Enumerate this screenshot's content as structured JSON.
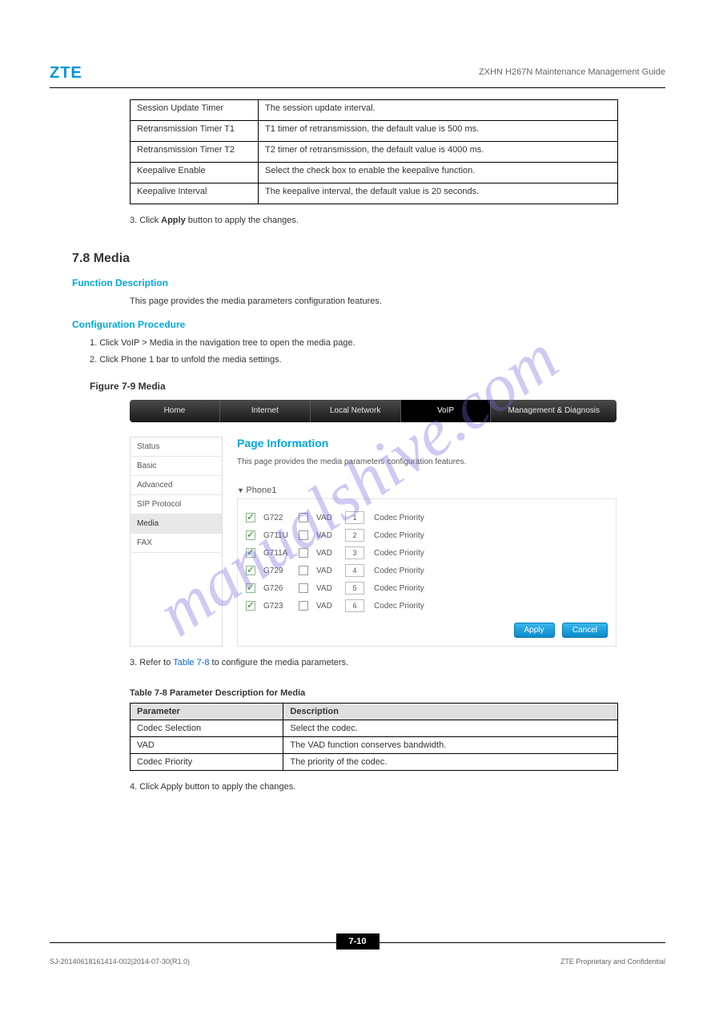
{
  "brand": "ZTE",
  "doc_title": "ZXHN H267N Maintenance Management Guide",
  "watermark": "manualshive.com",
  "param_table": [
    {
      "name": "Session Update Timer",
      "desc": "The session update interval."
    },
    {
      "name": "Retransmission Timer T1",
      "desc": "T1 timer of retransmission, the default value is 500 ms."
    },
    {
      "name": "Retransmission Timer T2",
      "desc": "T2 timer of retransmission, the default value is 4000 ms."
    },
    {
      "name": "Keepalive Enable",
      "desc": "Select the check box to enable the keepalive function."
    },
    {
      "name": "Keepalive Interval",
      "desc": "The keepalive interval, the default value is 20 seconds."
    }
  ],
  "step3": {
    "num": "3.",
    "text_prefix": "Click ",
    "btn": "Apply",
    "text_suffix": " button to apply the changes."
  },
  "heading": "7.8 Media",
  "func_label": "Function Description",
  "func_text": "This page provides the media parameters configuration features.",
  "conf_label": "Configuration Procedure",
  "conf_steps": [
    "1.  Click VoIP > Media in the navigation tree to open the media page.",
    "2.  Click Phone 1 bar to unfold the media settings."
  ],
  "figure_label": "Figure 7-9  Media",
  "nav": {
    "items": [
      "Home",
      "Internet",
      "Local Network",
      "VoIP",
      "Management & Diagnosis"
    ],
    "active": "VoIP"
  },
  "sidebar": {
    "items": [
      "Status",
      "Basic",
      "Advanced",
      "SIP Protocol",
      "Media",
      "FAX"
    ],
    "active": "Media"
  },
  "panel": {
    "title": "Page Information",
    "desc": "This page provides the media parameters configuration features.",
    "accordion_header": "Phone1",
    "codecs": [
      {
        "name": "G722",
        "codec_checked": true,
        "vad_label": "VAD",
        "priority": "1",
        "pri_label": "Codec Priority"
      },
      {
        "name": "G711U",
        "codec_checked": true,
        "vad_label": "VAD",
        "priority": "2",
        "pri_label": "Codec Priority"
      },
      {
        "name": "G711A",
        "codec_checked": true,
        "vad_label": "VAD",
        "priority": "3",
        "pri_label": "Codec Priority"
      },
      {
        "name": "G729",
        "codec_checked": true,
        "vad_label": "VAD",
        "priority": "4",
        "pri_label": "Codec Priority"
      },
      {
        "name": "G726",
        "codec_checked": true,
        "vad_label": "VAD",
        "priority": "5",
        "pri_label": "Codec Priority"
      },
      {
        "name": "G723",
        "codec_checked": true,
        "vad_label": "VAD",
        "priority": "6",
        "pri_label": "Codec Priority"
      }
    ],
    "apply_btn": "Apply",
    "cancel_btn": "Cancel"
  },
  "tbl_ref": {
    "prefix": "3.  Refer to ",
    "link": "Table 7-8",
    "suffix": " to configure the media parameters."
  },
  "table_caption": "Table 7-8  Parameter Description for Media",
  "desc_table": {
    "headers": [
      "Parameter",
      "Description"
    ],
    "rows": [
      [
        "Codec Selection",
        "Select the codec."
      ],
      [
        "VAD",
        "The VAD function conserves bandwidth."
      ],
      [
        "Codec Priority",
        "The priority of the codec."
      ]
    ]
  },
  "step4": {
    "num": "4.",
    "text_prefix": "Click ",
    "btn": "Apply",
    "text_suffix": " button to apply the changes."
  },
  "page_number": "7-10",
  "footer": {
    "left": "SJ-20140618161414-002|2014-07-30(R1.0)",
    "right": "ZTE Proprietary and Confidential"
  }
}
